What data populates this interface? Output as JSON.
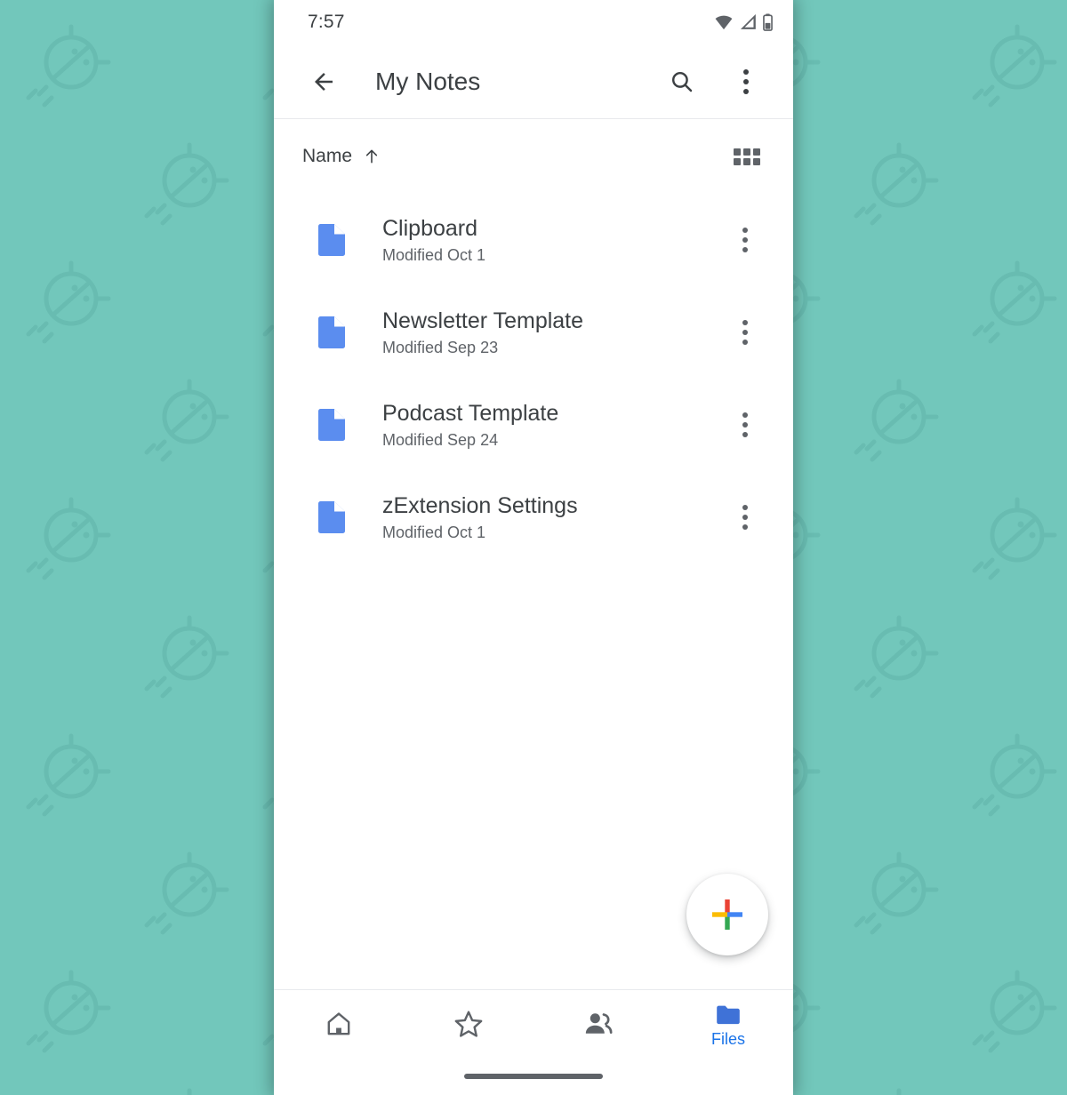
{
  "wallpaper": {
    "base_color": "#72c7bb",
    "motif_color": "#5fb3a8",
    "motif_name": "android-bug-head-pattern"
  },
  "status_bar": {
    "time": "7:57",
    "icons": [
      "wifi-icon",
      "cell-signal-icon",
      "battery-icon"
    ]
  },
  "app_bar": {
    "back_icon": "back-arrow-icon",
    "title": "My Notes",
    "search_icon": "search-icon",
    "overflow_icon": "overflow-menu-icon"
  },
  "sort_row": {
    "label": "Name",
    "direction_icon": "arrow-up-icon",
    "view_toggle_icon": "grid-view-icon"
  },
  "files": [
    {
      "name": "Clipboard",
      "meta": "Modified Oct 1",
      "icon": "document-icon",
      "icon_color": "#5b8def"
    },
    {
      "name": "Newsletter Template",
      "meta": "Modified Sep 23",
      "icon": "document-icon",
      "icon_color": "#5b8def"
    },
    {
      "name": "Podcast Template",
      "meta": "Modified Sep 24",
      "icon": "document-icon",
      "icon_color": "#5b8def"
    },
    {
      "name": "zExtension Settings",
      "meta": "Modified Oct 1",
      "icon": "document-icon",
      "icon_color": "#5b8def"
    }
  ],
  "fab": {
    "icon": "google-plus-icon",
    "colors": {
      "red": "#ea4335",
      "yellow": "#fbbc04",
      "blue": "#4285f4",
      "green": "#34a853"
    }
  },
  "bottom_nav": {
    "items": [
      {
        "icon": "home-icon",
        "label": "",
        "active": false
      },
      {
        "icon": "star-icon",
        "label": "",
        "active": false
      },
      {
        "icon": "people-icon",
        "label": "",
        "active": false
      },
      {
        "icon": "folder-icon",
        "label": "Files",
        "active": true
      }
    ],
    "active_color": "#1a73e8",
    "inactive_color": "#5f6368"
  },
  "gesture_bar": {
    "name": "gesture-navigation-pill"
  }
}
